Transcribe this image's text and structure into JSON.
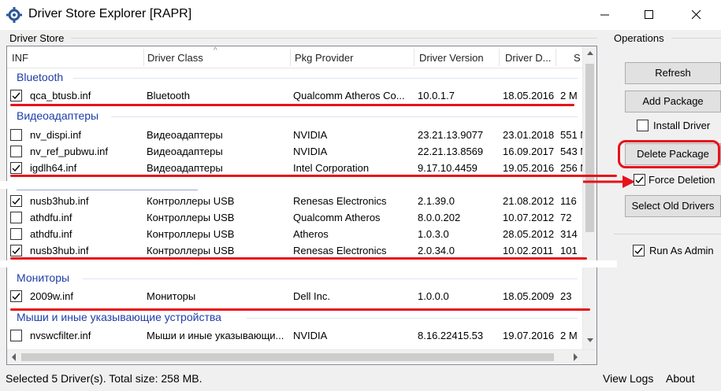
{
  "window": {
    "title": "Driver Store Explorer [RAPR]"
  },
  "driver_store": {
    "group_label": "Driver Store",
    "columns": [
      "INF",
      "Driver Class",
      "Pkg Provider",
      "Driver Version",
      "Driver D...",
      "S"
    ],
    "groups": [
      {
        "name": "Bluetooth",
        "rows": [
          {
            "checked": true,
            "inf": "qca_btusb.inf",
            "class": "Bluetooth",
            "provider": "Qualcomm Atheros Co...",
            "version": "10.0.1.7",
            "date": "18.05.2016",
            "size": "2 M"
          }
        ]
      },
      {
        "name": "Видеоадаптеры",
        "rows": [
          {
            "checked": false,
            "inf": "nv_dispi.inf",
            "class": "Видеоадаптеры",
            "provider": "NVIDIA",
            "version": "23.21.13.9077",
            "date": "23.01.2018",
            "size": "551 M"
          },
          {
            "checked": false,
            "inf": "nv_ref_pubwu.inf",
            "class": "Видеоадаптеры",
            "provider": "NVIDIA",
            "version": "22.21.13.8569",
            "date": "16.09.2017",
            "size": "543 M"
          },
          {
            "checked": true,
            "inf": "igdlh64.inf",
            "class": "Видеоадаптеры",
            "provider": "Intel Corporation",
            "version": "9.17.10.4459",
            "date": "19.05.2016",
            "size": "256 M"
          }
        ]
      },
      {
        "name": "",
        "rows": [
          {
            "checked": true,
            "inf": "nusb3hub.inf",
            "class": "Контроллеры USB",
            "provider": "Renesas Electronics",
            "version": "2.1.39.0",
            "date": "21.08.2012",
            "size": "116"
          },
          {
            "checked": false,
            "inf": "athdfu.inf",
            "class": "Контроллеры USB",
            "provider": "Qualcomm Atheros",
            "version": "8.0.0.202",
            "date": "10.07.2012",
            "size": "72"
          },
          {
            "checked": false,
            "inf": "athdfu.inf",
            "class": "Контроллеры USB",
            "provider": "Atheros",
            "version": "1.0.3.0",
            "date": "28.05.2012",
            "size": "314"
          },
          {
            "checked": true,
            "inf": "nusb3hub.inf",
            "class": "Контроллеры USB",
            "provider": "Renesas Electronics",
            "version": "2.0.34.0",
            "date": "10.02.2011",
            "size": "101"
          }
        ]
      },
      {
        "name": "Мониторы",
        "rows": [
          {
            "checked": true,
            "inf": "2009w.inf",
            "class": "Мониторы",
            "provider": "Dell Inc.",
            "version": "1.0.0.0",
            "date": "18.05.2009",
            "size": "23"
          }
        ]
      },
      {
        "name": "Мыши и иные указывающие устройства",
        "rows": [
          {
            "checked": false,
            "inf": "nvswcfilter.inf",
            "class": "Мыши и иные указывающи...",
            "provider": "NVIDIA",
            "version": "8.16.22415.53",
            "date": "19.07.2016",
            "size": "2 M"
          }
        ]
      }
    ]
  },
  "operations": {
    "group_label": "Operations",
    "refresh": "Refresh",
    "add_package": "Add Package",
    "install_driver": {
      "label": "Install Driver",
      "checked": false
    },
    "delete_package": "Delete Package",
    "force_deletion": {
      "label": "Force Deletion",
      "checked": true
    },
    "select_old": "Select Old Drivers",
    "run_as_admin": {
      "label": "Run As Admin",
      "checked": true
    }
  },
  "status": {
    "text": "Selected 5 Driver(s). Total size: 258 MB.",
    "view_logs": "View Logs",
    "about": "About"
  },
  "colors": {
    "annotation_red": "#e6121b",
    "group_blue": "#1e3da8"
  }
}
